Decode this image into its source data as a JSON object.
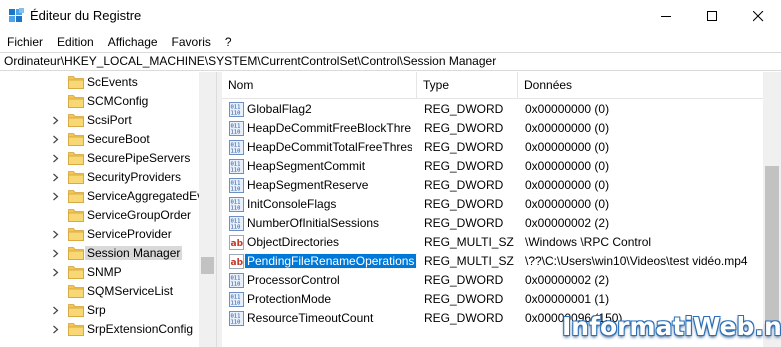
{
  "window": {
    "title": "Éditeur du Registre",
    "icons": [
      "registry-icon",
      "minimize-icon",
      "maximize-icon",
      "close-icon"
    ]
  },
  "menu": [
    "Fichier",
    "Edition",
    "Affichage",
    "Favoris",
    "?"
  ],
  "address": "Ordinateur\\HKEY_LOCAL_MACHINE\\SYSTEM\\CurrentControlSet\\Control\\Session Manager",
  "tree": {
    "items": [
      {
        "label": "ScEvents",
        "expandable": false,
        "selected": false
      },
      {
        "label": "SCMConfig",
        "expandable": false,
        "selected": false
      },
      {
        "label": "ScsiPort",
        "expandable": true,
        "selected": false
      },
      {
        "label": "SecureBoot",
        "expandable": true,
        "selected": false
      },
      {
        "label": "SecurePipeServers",
        "expandable": true,
        "selected": false
      },
      {
        "label": "SecurityProviders",
        "expandable": true,
        "selected": false
      },
      {
        "label": "ServiceAggregatedEv",
        "expandable": true,
        "selected": false
      },
      {
        "label": "ServiceGroupOrder",
        "expandable": false,
        "selected": false
      },
      {
        "label": "ServiceProvider",
        "expandable": true,
        "selected": false
      },
      {
        "label": "Session Manager",
        "expandable": true,
        "selected": true
      },
      {
        "label": "SNMP",
        "expandable": true,
        "selected": false
      },
      {
        "label": "SQMServiceList",
        "expandable": false,
        "selected": false
      },
      {
        "label": "Srp",
        "expandable": true,
        "selected": false
      },
      {
        "label": "SrpExtensionConfig",
        "expandable": true,
        "selected": false
      }
    ]
  },
  "list": {
    "columns": [
      "Nom",
      "Type",
      "Données"
    ],
    "rows": [
      {
        "name": "GlobalFlag2",
        "type": "REG_DWORD",
        "data": "0x00000000 (0)",
        "icon": "binary",
        "selected": false
      },
      {
        "name": "HeapDeCommitFreeBlockThre...",
        "type": "REG_DWORD",
        "data": "0x00000000 (0)",
        "icon": "binary",
        "selected": false
      },
      {
        "name": "HeapDeCommitTotalFreeThres...",
        "type": "REG_DWORD",
        "data": "0x00000000 (0)",
        "icon": "binary",
        "selected": false
      },
      {
        "name": "HeapSegmentCommit",
        "type": "REG_DWORD",
        "data": "0x00000000 (0)",
        "icon": "binary",
        "selected": false
      },
      {
        "name": "HeapSegmentReserve",
        "type": "REG_DWORD",
        "data": "0x00000000 (0)",
        "icon": "binary",
        "selected": false
      },
      {
        "name": "InitConsoleFlags",
        "type": "REG_DWORD",
        "data": "0x00000000 (0)",
        "icon": "binary",
        "selected": false
      },
      {
        "name": "NumberOfInitialSessions",
        "type": "REG_DWORD",
        "data": "0x00000002 (2)",
        "icon": "binary",
        "selected": false
      },
      {
        "name": "ObjectDirectories",
        "type": "REG_MULTI_SZ",
        "data": "\\Windows \\RPC Control",
        "icon": "string",
        "selected": false
      },
      {
        "name": "PendingFileRenameOperations",
        "type": "REG_MULTI_SZ",
        "data": "\\??\\C:\\Users\\win10\\Videos\\test vidéo.mp4",
        "icon": "string",
        "selected": true
      },
      {
        "name": "ProcessorControl",
        "type": "REG_DWORD",
        "data": "0x00000002 (2)",
        "icon": "binary",
        "selected": false
      },
      {
        "name": "ProtectionMode",
        "type": "REG_DWORD",
        "data": "0x00000001 (1)",
        "icon": "binary",
        "selected": false
      },
      {
        "name": "ResourceTimeoutCount",
        "type": "REG_DWORD",
        "data": "0x00000096 (150)",
        "icon": "binary",
        "selected": false
      }
    ]
  },
  "watermark": "InformatiWeb.net",
  "colors": {
    "selection": "#0078d7",
    "folder": "#f3c552",
    "accent": "#2a6fb6"
  }
}
